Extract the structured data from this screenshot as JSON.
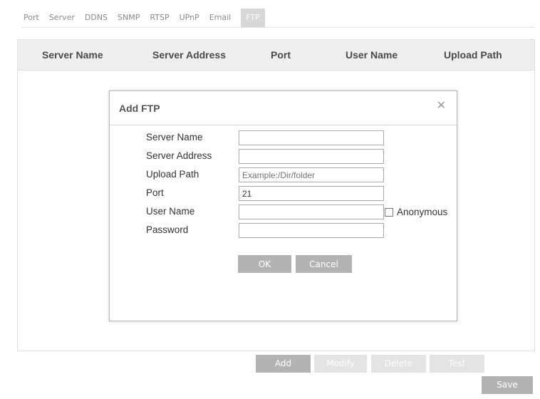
{
  "tabs": [
    {
      "label": "Port"
    },
    {
      "label": "Server"
    },
    {
      "label": "DDNS"
    },
    {
      "label": "SNMP"
    },
    {
      "label": "RTSP"
    },
    {
      "label": "UPnP"
    },
    {
      "label": "Email"
    },
    {
      "label": "FTP",
      "active": true
    }
  ],
  "table": {
    "columns": [
      "Server Name",
      "Server Address",
      "Port",
      "User Name",
      "Upload Path"
    ]
  },
  "dialog": {
    "title": "Add FTP",
    "close_icon": "close-icon",
    "fields": [
      {
        "label": "Server Name",
        "value": "",
        "placeholder": ""
      },
      {
        "label": "Server Address",
        "value": "",
        "placeholder": ""
      },
      {
        "label": "Upload Path",
        "value": "",
        "placeholder": "Example:/Dir/folder"
      },
      {
        "label": "Port",
        "value": "21",
        "placeholder": ""
      },
      {
        "label": "User Name",
        "value": "",
        "placeholder": ""
      },
      {
        "label": "Password",
        "value": "",
        "placeholder": ""
      }
    ],
    "anonymous_label": "Anonymous",
    "anonymous_checked": false,
    "ok_label": "OK",
    "cancel_label": "Cancel"
  },
  "actions": {
    "add_label": "Add",
    "modify_label": "Modify",
    "delete_label": "Delete",
    "test_label": "Test",
    "save_label": "Save"
  },
  "colors": {
    "active_tab_bg": "#d7d7d7",
    "header_bg": "#efefef",
    "button_gray": "#b3b3b3",
    "button_disabled": "#e4e4e4"
  }
}
